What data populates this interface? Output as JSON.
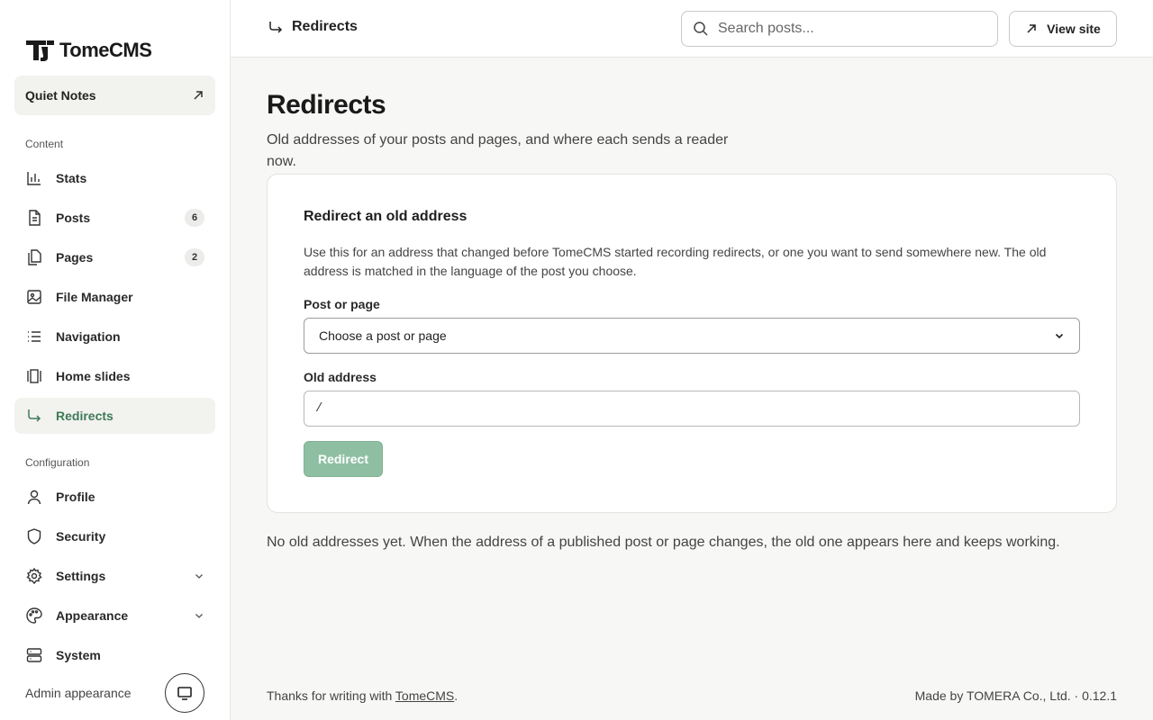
{
  "app": {
    "name": "TomeCMS"
  },
  "site": {
    "name": "Quiet Notes"
  },
  "sidebar": {
    "content_label": "Content",
    "config_label": "Configuration",
    "items": {
      "stats": {
        "label": "Stats",
        "icon": "bar-chart-icon"
      },
      "posts": {
        "label": "Posts",
        "count": "6",
        "icon": "document-icon"
      },
      "pages": {
        "label": "Pages",
        "count": "2",
        "icon": "pages-icon"
      },
      "files": {
        "label": "File Manager",
        "icon": "image-icon"
      },
      "navigation": {
        "label": "Navigation",
        "icon": "list-icon"
      },
      "slides": {
        "label": "Home slides",
        "icon": "slides-icon"
      },
      "redirects": {
        "label": "Redirects",
        "icon": "redirect-arrow-icon",
        "active": true
      },
      "profile": {
        "label": "Profile",
        "icon": "user-icon"
      },
      "security": {
        "label": "Security",
        "icon": "shield-icon"
      },
      "settings": {
        "label": "Settings",
        "icon": "gear-icon"
      },
      "appearance": {
        "label": "Appearance",
        "icon": "palette-icon"
      },
      "system": {
        "label": "System",
        "icon": "server-icon"
      }
    },
    "admin_appearance": "Admin appearance"
  },
  "header": {
    "breadcrumb": "Redirects",
    "search_placeholder": "Search posts...",
    "view_site": "View site"
  },
  "main": {
    "title": "Redirects",
    "description": "Old addresses of your posts and pages, and where each sends a reader now.",
    "form": {
      "title": "Redirect an old address",
      "description": "Use this for an address that changed before TomeCMS started recording redirects, or one you want to send somewhere new. The old address is matched in the language of the post you choose.",
      "post_label": "Post or page",
      "post_select_value": "Choose a post or page",
      "old_address_label": "Old address",
      "old_address_value": "/",
      "submit": "Redirect"
    },
    "empty_note": "No old addresses yet. When the address of a published post or page changes, the old one appears here and keeps working."
  },
  "footer": {
    "thanks_prefix": "Thanks for writing with ",
    "thanks_link": "TomeCMS",
    "thanks_suffix": ".",
    "made_by": "Made by TOMERA Co., Ltd. · 0.12.1"
  },
  "colors": {
    "accent": "#3e7a58",
    "button_disabled": "#8fbfa2"
  }
}
